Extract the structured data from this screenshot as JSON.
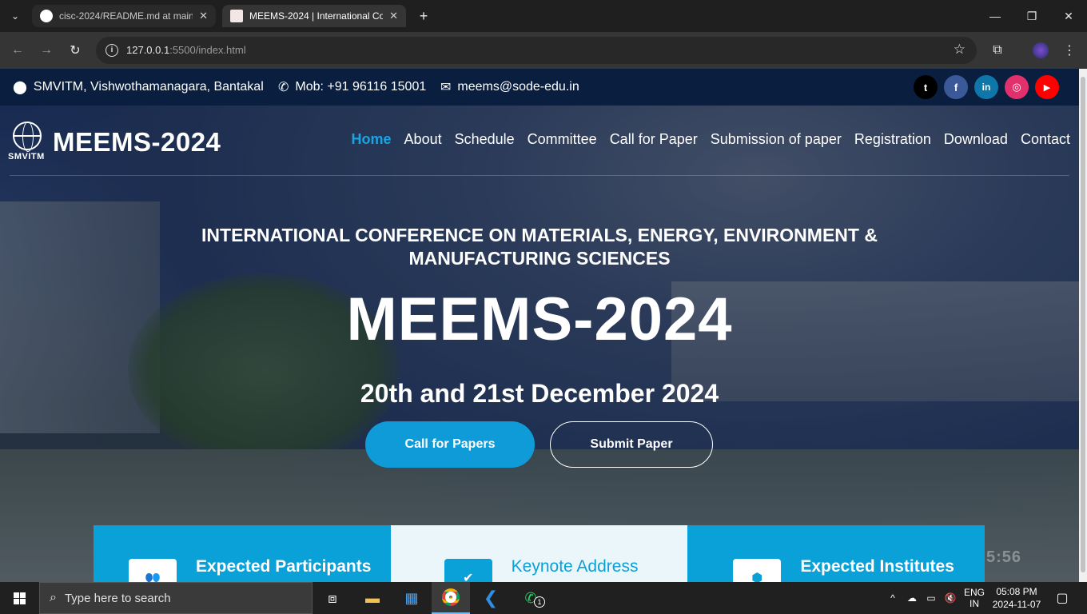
{
  "browser": {
    "tabs": [
      {
        "title": "cisc-2024/README.md at main",
        "active": false
      },
      {
        "title": "MEEMS-2024 | International Co",
        "active": true
      }
    ],
    "url_host": "127.0.0.1",
    "url_rest": ":5500/index.html"
  },
  "topbar": {
    "address": "SMVITM, Vishwothamanagara, Bantakal",
    "phone": "Mob: +91 96116 15001",
    "email": "meems@sode-edu.in",
    "social": [
      {
        "name": "twitter",
        "glyph": "t",
        "color": "#000000"
      },
      {
        "name": "facebook",
        "glyph": "f",
        "color": "#3b5998"
      },
      {
        "name": "linkedin",
        "glyph": "in",
        "color": "#0e76a8"
      },
      {
        "name": "instagram",
        "glyph": "◎",
        "color": "#e1306c"
      },
      {
        "name": "youtube",
        "glyph": "▶",
        "color": "#ff0000"
      }
    ]
  },
  "header": {
    "logo_text": "SMVITM",
    "brand": "MEEMS-2024",
    "nav": [
      "Home",
      "About",
      "Schedule",
      "Committee",
      "Call for Paper",
      "Submission of paper",
      "Registration",
      "Download",
      "Contact"
    ],
    "active_nav": "Home"
  },
  "hero": {
    "subtitle": "INTERNATIONAL CONFERENCE ON MATERIALS, ENERGY, ENVIRONMENT & MANUFACTURING SCIENCES",
    "title": "MEEMS-2024",
    "dates": "20th and 21st December 2024",
    "primary_button": "Call for Papers",
    "secondary_button": "Submit Paper",
    "countdown_partial": "5:56"
  },
  "stats": [
    {
      "label": "Expected Participants",
      "style": "blue"
    },
    {
      "label": "Keynote Address",
      "style": "light"
    },
    {
      "label": "Expected Institutes",
      "style": "blue"
    }
  ],
  "taskbar": {
    "search_placeholder": "Type here to search",
    "language": "ENG",
    "region": "IN",
    "time": "05:08 PM",
    "date": "2024-11-07",
    "whatsapp_badge": "1"
  },
  "colors": {
    "accent": "#0e9bd8",
    "topbar_bg": "#0a1e3f",
    "nav_active": "#1aa4e3"
  }
}
